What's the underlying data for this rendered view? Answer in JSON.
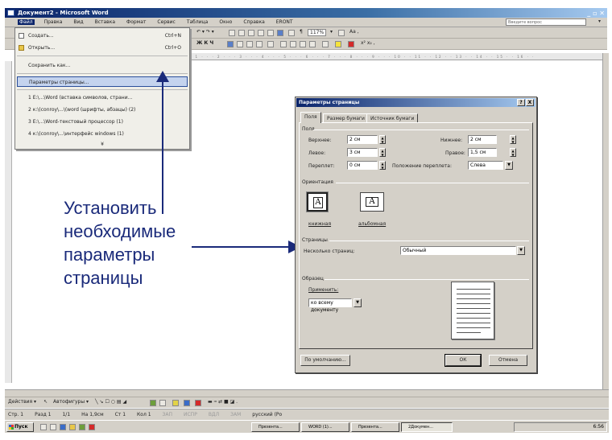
{
  "window": {
    "title": "Документ2 - Microsoft Word",
    "controls": "_ ▫ ✕"
  },
  "menubar": {
    "items": [
      "Файл",
      "Правка",
      "Вид",
      "Вставка",
      "Формат",
      "Сервис",
      "Таблица",
      "Окно",
      "Справка",
      "ERONT"
    ],
    "help_placeholder": "Введите вопрос"
  },
  "toolbar": {
    "zoom": "117%",
    "undo": "↶ ▾ ↷ ▾",
    "format": "Ж К Ч"
  },
  "file_menu": {
    "items": [
      {
        "label": "Создать...",
        "shortcut": "Ctrl+N"
      },
      {
        "label": "Открыть...",
        "shortcut": "Ctrl+O"
      },
      {
        "label": "Сохранить как...",
        "shortcut": ""
      },
      {
        "label": "Параметры страницы...",
        "shortcut": ""
      },
      {
        "label": "1 Е:\\...\\Word (вставка символов, страни...",
        "shortcut": ""
      },
      {
        "label": "2 к:\\(conroy\\...\\(word (шрифты, абзацы) (2)",
        "shortcut": ""
      },
      {
        "label": "3 Е:\\...\\Word-текстовый процессор (1)",
        "shortcut": ""
      },
      {
        "label": "4 к:\\(conroy\\...\\интерфейс windows (1)",
        "shortcut": ""
      }
    ],
    "more": "¥"
  },
  "annotation": {
    "lines": [
      "Установить",
      "необходимые",
      "параметры",
      "страницы"
    ]
  },
  "dialog": {
    "title": "Параметры страницы",
    "title_buttons": [
      "?",
      "X"
    ],
    "tabs": [
      "Поля",
      "Размер бумаги",
      "Источник бумаги"
    ],
    "fields_group": "Поля",
    "top_label": "Верхнее:",
    "top_value": "2 см",
    "bottom_label": "Нижнее:",
    "bottom_value": "2 см",
    "left_label": "Левое:",
    "left_value": "3 см",
    "right_label": "Правое:",
    "right_value": "1,5 см",
    "gutter_label": "Переплет:",
    "gutter_value": "0 см",
    "gutter_pos_label": "Положение переплета:",
    "gutter_pos_value": "Слева",
    "orientation_group": "Ориентация",
    "portrait_label": "книжная",
    "landscape_label": "альбомная",
    "pages_group": "Страницы",
    "multiple_pages_label": "Несколько страниц:",
    "multiple_pages_value": "Обычный",
    "sample_group": "Образец",
    "apply_label": "Применить:",
    "apply_value": "ко всему документу",
    "default_button": "По умолчанию...",
    "ok_button": "ОК",
    "cancel_button": "Отмена"
  },
  "drawbar": {
    "actions": "Действия ▾",
    "autoshapes": "Автофигуры ▾"
  },
  "statusbar": {
    "items": [
      "Стр. 1",
      "Разд 1",
      "1/1",
      "На 1,9см",
      "Ст 1",
      "Кол 1"
    ],
    "modes": [
      "ЗАП",
      "ИСПР",
      "ВДЛ",
      "ЗАМ"
    ],
    "lang": "русский (Ро"
  },
  "taskbar": {
    "start": "Пуск",
    "tasks": [
      "Презента...",
      "WORD (1)...",
      "Презента...",
      "2Докумен..."
    ],
    "clock": "6:56"
  }
}
